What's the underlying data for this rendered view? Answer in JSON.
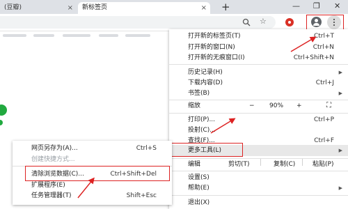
{
  "tabs": [
    {
      "label": "(豆瓣)",
      "close": "×"
    },
    {
      "label": "新标签页",
      "close": "×"
    }
  ],
  "window": {
    "new_tab": "+",
    "minimize": "—",
    "maximize": "❐",
    "close": "✕"
  },
  "toolbar": {
    "search_icon": "search-icon",
    "star": "☆"
  },
  "main_menu": {
    "new_tab": {
      "label": "打开新的标签页(T)",
      "shortcut": "Ctrl+T"
    },
    "new_window": {
      "label": "打开新的窗口(N)",
      "shortcut": "Ctrl+N"
    },
    "incognito": {
      "label": "打开新的无痕窗口(I)",
      "shortcut": "Ctrl+Shift+N"
    },
    "history": {
      "label": "历史记录(H)"
    },
    "downloads": {
      "label": "下载内容(D)",
      "shortcut": "Ctrl+J"
    },
    "bookmarks": {
      "label": "书签(B)"
    },
    "zoom": {
      "label": "缩放",
      "minus": "−",
      "value": "90%",
      "plus": "+",
      "fullscreen": "⛶"
    },
    "print": {
      "label": "打印(P)...",
      "shortcut": "Ctrl+P"
    },
    "cast": {
      "label": "投射(C)..."
    },
    "find": {
      "label": "查找(F)...",
      "shortcut": "Ctrl+F"
    },
    "more_tools": {
      "label": "更多工具(L)"
    },
    "edit": {
      "label": "编辑",
      "cut": "剪切(T)",
      "copy": "复制(C)",
      "paste": "粘贴(P)"
    },
    "settings": {
      "label": "设置(S)"
    },
    "help": {
      "label": "帮助(E)"
    },
    "exit": {
      "label": "退出(X)"
    }
  },
  "sub_menu": {
    "save_page": {
      "label": "网页另存为(A)...",
      "shortcut": "Ctrl+S"
    },
    "create_shortcut": {
      "label": "创建快捷方式..."
    },
    "clear_data": {
      "label": "清除浏览数据(C)...",
      "shortcut": "Ctrl+Shift+Del"
    },
    "extensions": {
      "label": "扩展程序(E)"
    },
    "task_manager": {
      "label": "任务管理器(T)",
      "shortcut": "Shift+Esc"
    }
  },
  "colors": {
    "annotation": "#d22222",
    "highlight": "#e8e8e8",
    "accent_green": "#21a93f"
  }
}
